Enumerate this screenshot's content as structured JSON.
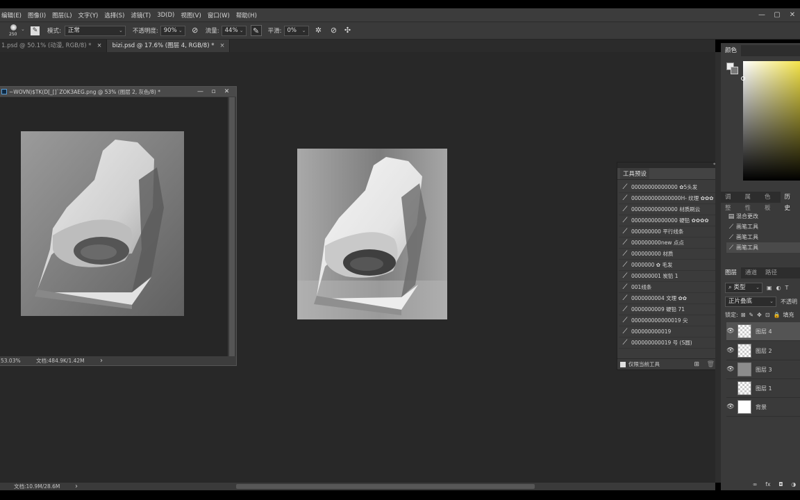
{
  "menu": [
    "编辑(E)",
    "图像(I)",
    "图层(L)",
    "文字(Y)",
    "选择(S)",
    "滤镜(T)",
    "3D(D)",
    "视图(V)",
    "窗口(W)",
    "帮助(H)"
  ],
  "window_controls": [
    "—",
    "▢",
    "✕"
  ],
  "options": {
    "brush_size": "250",
    "mode_label": "模式:",
    "mode_value": "正常",
    "opacity_label": "不透明度:",
    "opacity_value": "90%",
    "flow_label": "流量:",
    "flow_value": "44%",
    "smooth_label": "平滑:",
    "smooth_value": "0%"
  },
  "tabs": [
    {
      "label": "1.psd @ 50.1% (动漫, RGB/8) *",
      "close": "×"
    },
    {
      "label": "bizi.psd @ 17.6% (图层 4, RGB/8) *",
      "close": "×"
    }
  ],
  "doc_window": {
    "title": "~WOVN)$TK(D[_[]`ZOK3AEG.png @ 53% (图层 2, 灰色/8) *",
    "buttons": [
      "—",
      "▫",
      "✕"
    ],
    "zoom": "53.03%",
    "doc_info": "文档:484.9K/1.42M",
    "arrow": "›"
  },
  "status": {
    "doc_info": "文档:10.9M/28.6M",
    "arrow": "›"
  },
  "presets": {
    "title": "工具预设",
    "items": [
      "00000000000000 ✿5头发",
      "000000000000000H- 纹理 ✿✿✿",
      "00000000000000 材质刷云",
      "00000000000000 硬铅 ✿✿✿✿",
      "000000000 平行线条",
      "000000000new 点点",
      "000000000 材质",
      "0000000 ✿ 毛发",
      "000000001 炭铅 1",
      "001线条",
      "0000000004 文理 ✿✿",
      "0000000009 硬铅 71",
      "000000000000019 尖",
      "000000000019",
      "000000000019 号   (S圆)"
    ],
    "footer": "仅限当前工具"
  },
  "right_panel": {
    "color_tab": "颜色",
    "history_tabs": [
      "调整",
      "属性",
      "色板",
      "历史"
    ],
    "history_items": [
      "混合更改",
      "画笔工具",
      "画笔工具",
      "画笔工具"
    ],
    "layers_tabs": [
      "图层",
      "通道",
      "路径"
    ],
    "filter_kind": "类型",
    "blend_mode": "正片叠底",
    "opacity_label": "不透明",
    "lock_label": "锁定:",
    "fill_label": "填充",
    "layers": [
      {
        "name": "图层 4",
        "visible": true,
        "selected": true
      },
      {
        "name": "图层 2",
        "visible": true,
        "selected": false
      },
      {
        "name": "图层 3",
        "visible": true,
        "selected": false
      },
      {
        "name": "图层 1",
        "visible": false,
        "selected": false
      },
      {
        "name": "背景",
        "visible": true,
        "selected": false
      }
    ],
    "bottom_icons": [
      "link-icon",
      "fx-icon",
      "mask-icon",
      "adjustment-icon"
    ],
    "bottom_symbols": [
      "∞",
      "fx",
      "◘",
      "◑"
    ]
  },
  "colors": {
    "bg": "#282828",
    "panel": "#3a3a3a",
    "accent_yellow": "#f4e44a"
  }
}
